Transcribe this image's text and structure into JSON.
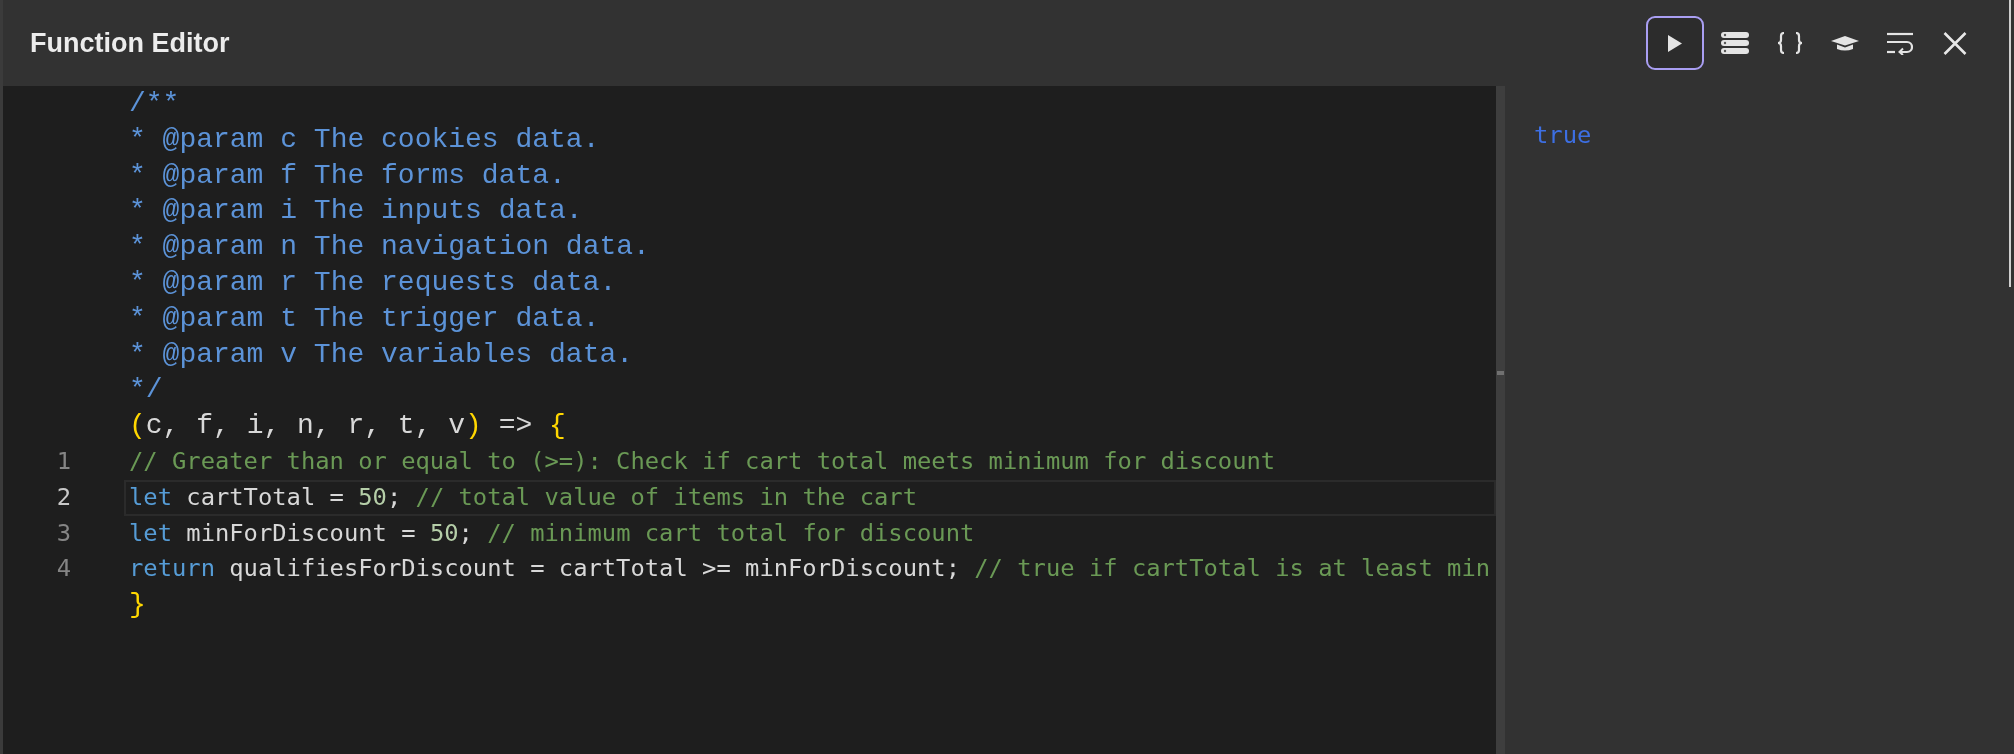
{
  "window": {
    "title": "Function Editor"
  },
  "toolbar": [
    {
      "kind": "run",
      "focused": true
    },
    {
      "kind": "stack",
      "focused": false
    },
    {
      "kind": "format",
      "focused": false
    },
    {
      "kind": "learn",
      "focused": false
    },
    {
      "kind": "wrap",
      "focused": false
    },
    {
      "kind": "close",
      "focused": false
    }
  ],
  "editor": {
    "lines": [
      {
        "kind": "wrapper",
        "tokens": [
          {
            "kind": "doc",
            "text": "/**"
          }
        ]
      },
      {
        "kind": "wrapper",
        "tokens": [
          {
            "kind": "doc",
            "text": "* @param c The cookies data."
          }
        ]
      },
      {
        "kind": "wrapper",
        "tokens": [
          {
            "kind": "doc",
            "text": "* @param f The forms data."
          }
        ]
      },
      {
        "kind": "wrapper",
        "tokens": [
          {
            "kind": "doc",
            "text": "* @param i The inputs data."
          }
        ]
      },
      {
        "kind": "wrapper",
        "tokens": [
          {
            "kind": "doc",
            "text": "* @param n The navigation data."
          }
        ]
      },
      {
        "kind": "wrapper",
        "tokens": [
          {
            "kind": "doc",
            "text": "* @param r The requests data."
          }
        ]
      },
      {
        "kind": "wrapper",
        "tokens": [
          {
            "kind": "doc",
            "text": "* @param t The trigger data."
          }
        ]
      },
      {
        "kind": "wrapper",
        "tokens": [
          {
            "kind": "doc",
            "text": "* @param v The variables data."
          }
        ]
      },
      {
        "kind": "wrapper",
        "tokens": [
          {
            "kind": "doc",
            "text": "*/"
          }
        ]
      },
      {
        "kind": "wrapper",
        "tokens": [
          {
            "kind": "bracket",
            "text": "("
          },
          {
            "kind": "plain",
            "text": "c, f, i, n, r, t, v"
          },
          {
            "kind": "bracket",
            "text": ")"
          },
          {
            "kind": "plain",
            "text": " => "
          },
          {
            "kind": "bracket",
            "text": "{"
          }
        ]
      },
      {
        "kind": "code",
        "number": "1",
        "active": false,
        "tokens": [
          {
            "kind": "comment",
            "text": "// Greater than or equal to (>=): Check if cart total meets minimum for discount"
          }
        ]
      },
      {
        "kind": "code",
        "number": "2",
        "active": true,
        "tokens": [
          {
            "kind": "keyword",
            "text": "let"
          },
          {
            "kind": "plain",
            "text": " cartTotal = "
          },
          {
            "kind": "number",
            "text": "50"
          },
          {
            "kind": "plain",
            "text": "; "
          },
          {
            "kind": "comment",
            "text": "// total value of items in the cart"
          }
        ]
      },
      {
        "kind": "code",
        "number": "3",
        "active": false,
        "tokens": [
          {
            "kind": "keyword",
            "text": "let"
          },
          {
            "kind": "plain",
            "text": " minForDiscount = "
          },
          {
            "kind": "number",
            "text": "50"
          },
          {
            "kind": "plain",
            "text": "; "
          },
          {
            "kind": "comment",
            "text": "// minimum cart total for discount"
          }
        ]
      },
      {
        "kind": "code",
        "number": "4",
        "active": false,
        "tokens": [
          {
            "kind": "keyword",
            "text": "return"
          },
          {
            "kind": "plain",
            "text": " qualifiesForDiscount = cartTotal >= minForDiscount; "
          },
          {
            "kind": "comment",
            "text": "// true if cartTotal is at least min"
          }
        ]
      },
      {
        "kind": "wrapper",
        "tokens": [
          {
            "kind": "bracket",
            "text": "}"
          }
        ]
      }
    ]
  },
  "output": {
    "value": "true"
  }
}
